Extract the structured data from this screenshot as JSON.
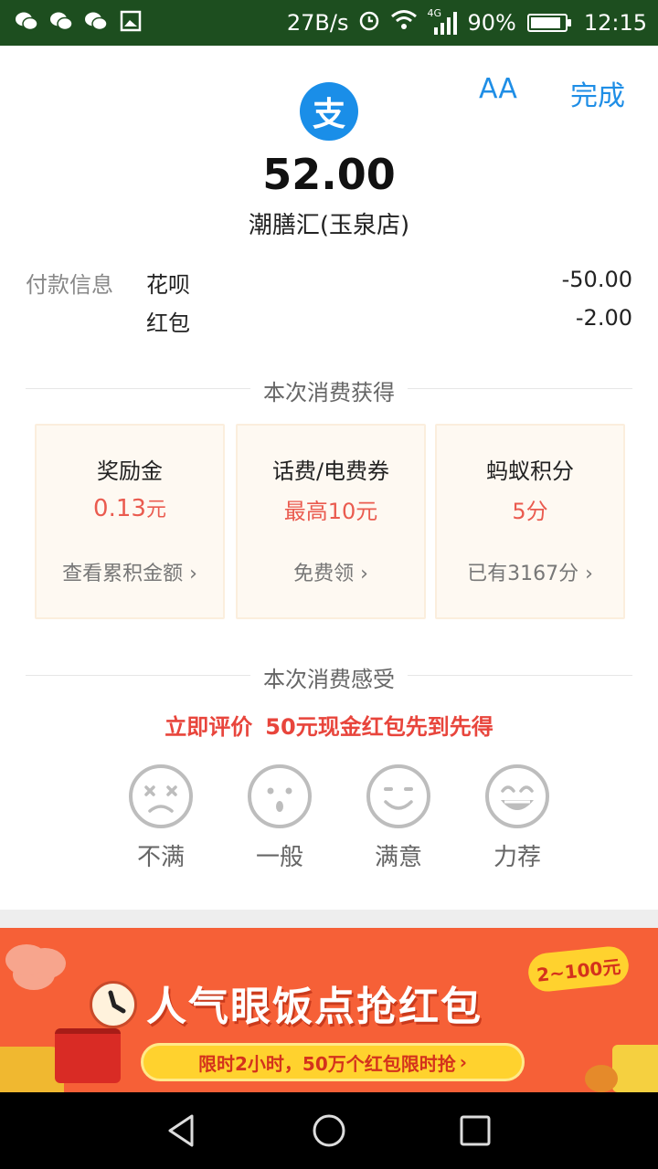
{
  "status_bar": {
    "network_speed": "27B/s",
    "network_type": "4G",
    "battery_percent": "90%",
    "battery_level": 0.9,
    "time": "12:15",
    "icons": [
      "wechat-icon",
      "wechat-icon",
      "wechat-icon",
      "gallery-icon",
      "alarm-icon",
      "wifi-icon",
      "signal-icon",
      "battery-icon"
    ]
  },
  "header": {
    "font_size_button": "AA",
    "done_button": "完成"
  },
  "payment": {
    "logo_icon": "alipay-logo",
    "logo_char": "支",
    "logo_color": "#1a8ee8",
    "amount": "52.00",
    "merchant": "潮膳汇(玉泉店)",
    "info_label": "付款信息",
    "items": [
      {
        "name": "花呗",
        "value": "-50.00"
      },
      {
        "name": "红包",
        "value": "-2.00"
      }
    ]
  },
  "rewards": {
    "section_title": "本次消费获得",
    "cards": [
      {
        "title": "奖励金",
        "value": "0.13",
        "unit": "元",
        "link": "查看累积金额"
      },
      {
        "title": "话费/电费券",
        "value": "最高10元",
        "unit": "",
        "link": "免费领"
      },
      {
        "title": "蚂蚁积分",
        "value": "5分",
        "unit": "",
        "link": "已有3167分"
      }
    ]
  },
  "rating": {
    "section_title": "本次消费感受",
    "promo_part1": "立即评价",
    "promo_part2": "50元现金红包先到先得",
    "promo_color": "#e8453c",
    "options": [
      {
        "label": "不满",
        "icon": "dissatisfied-face-icon"
      },
      {
        "label": "一般",
        "icon": "neutral-face-icon"
      },
      {
        "label": "满意",
        "icon": "satisfied-face-icon"
      },
      {
        "label": "力荐",
        "icon": "recommend-face-icon"
      }
    ]
  },
  "banner": {
    "title": "人气眼饭点抢红包",
    "badge": "2~100元",
    "subtitle": "限时2小时，50万个红包限时抢",
    "bg_color": "#f66037"
  },
  "nav_bar": {
    "icons": [
      "back-icon",
      "home-icon",
      "recents-icon"
    ]
  }
}
